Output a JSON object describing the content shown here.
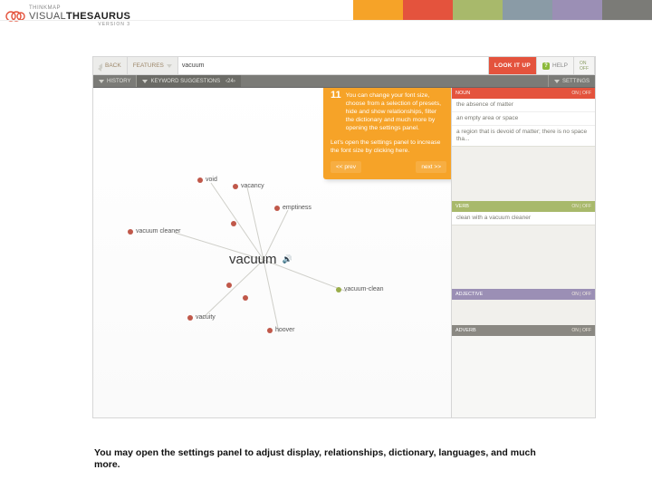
{
  "colors": {
    "topstrip": [
      "#f6a328",
      "#e4533d",
      "#a8b96b",
      "#8a9ba6",
      "#9b8fb5",
      "#7b7b77"
    ]
  },
  "logo": {
    "thin": "THINKMAP",
    "brand1": "VISUAL",
    "brand2": "THESAURUS",
    "sub": "VERSION 3"
  },
  "nav": {
    "back": "BACK",
    "features": "FEATURES",
    "search_value": "vacuum",
    "lookup": "LOOK IT UP",
    "help": "HELP",
    "onoff": "ON\nOFF"
  },
  "subnav": {
    "history": "HISTORY",
    "suggestions": "KEYWORD SUGGESTIONS",
    "settings": "SETTINGS"
  },
  "graph": {
    "center": "vacuum",
    "nodes": {
      "void": "void",
      "vacancy": "vacancy",
      "emptiness": "emptiness",
      "vacuum_cleaner": "vacuum cleaner",
      "vacuity": "vacuity",
      "hoover": "hoover",
      "vacuum_clean": "vacuum-clean"
    }
  },
  "tooltip": {
    "step": "11",
    "p1": "You can change your font size, choose from a selection of presets, hide and show relationships, filter the dictionary and much more by opening the settings panel.",
    "p2": "Let's open the settings panel to increase the font size by clicking here.",
    "prev": "<< prev",
    "next": "next >>"
  },
  "sidebar": {
    "noun_head": "NOUN",
    "noun_mini": "ON | OFF",
    "noun_rows": [
      "the absence of matter",
      "an empty area or space",
      "a region that is devoid of matter; there is no space tha..."
    ],
    "verb_head": "VERB",
    "verb_mini": "ON | OFF",
    "verb_rows": [
      "clean with a vacuum cleaner"
    ],
    "adj_head": "ADJECTIVE",
    "adj_mini": "ON | OFF",
    "adv_head": "ADVERB",
    "adv_mini": "ON | OFF"
  },
  "caption": "You may open the settings panel to adjust display, relationships, dictionary, languages, and much more."
}
